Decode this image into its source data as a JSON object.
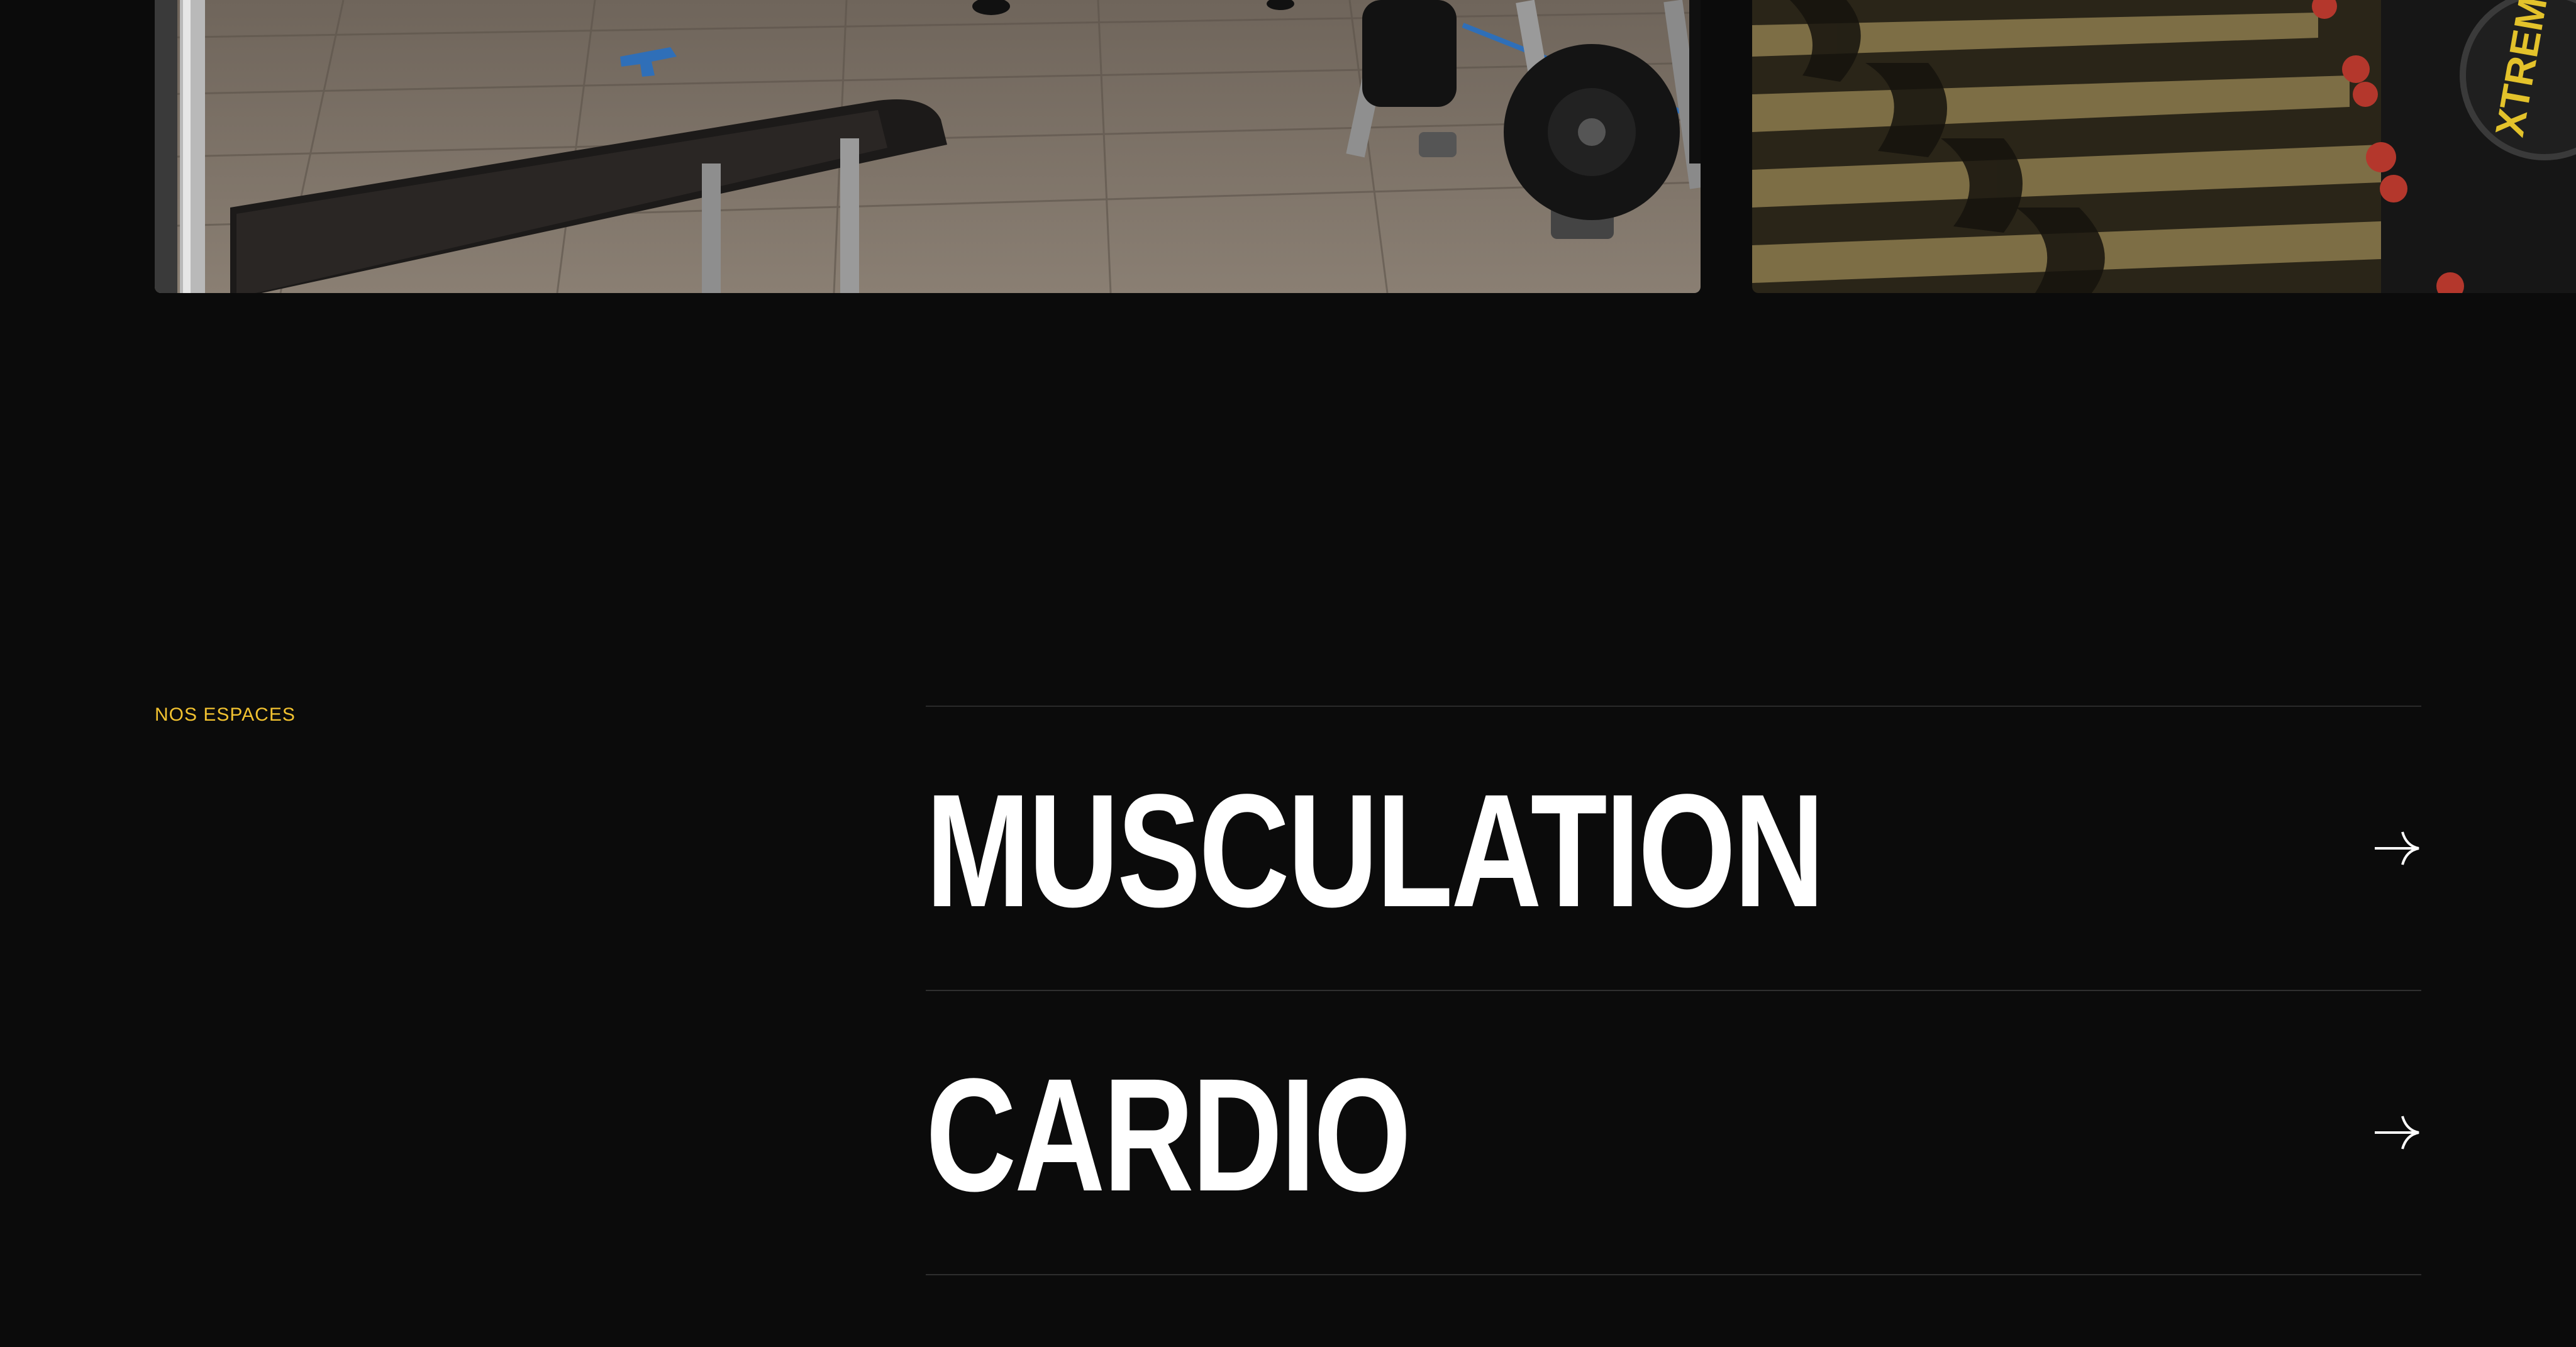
{
  "gallery": {
    "images": [
      {
        "alt": "gym floor with weight bench and plate rack",
        "icon": "photo-weights"
      },
      {
        "alt": "row of spinning bikes casting shadows",
        "icon": "photo-bikes",
        "brand_text": "XTREME"
      }
    ]
  },
  "spaces": {
    "eyebrow": "NOS ESPACES",
    "items": [
      {
        "label": "MUSCULATION",
        "icon": "arrow-right-icon"
      },
      {
        "label": "CARDIO",
        "icon": "arrow-right-icon"
      }
    ]
  },
  "colors": {
    "background": "#0b0b0b",
    "accent": "#f2c230",
    "text": "#ffffff",
    "divider": "#2f2f2f"
  }
}
